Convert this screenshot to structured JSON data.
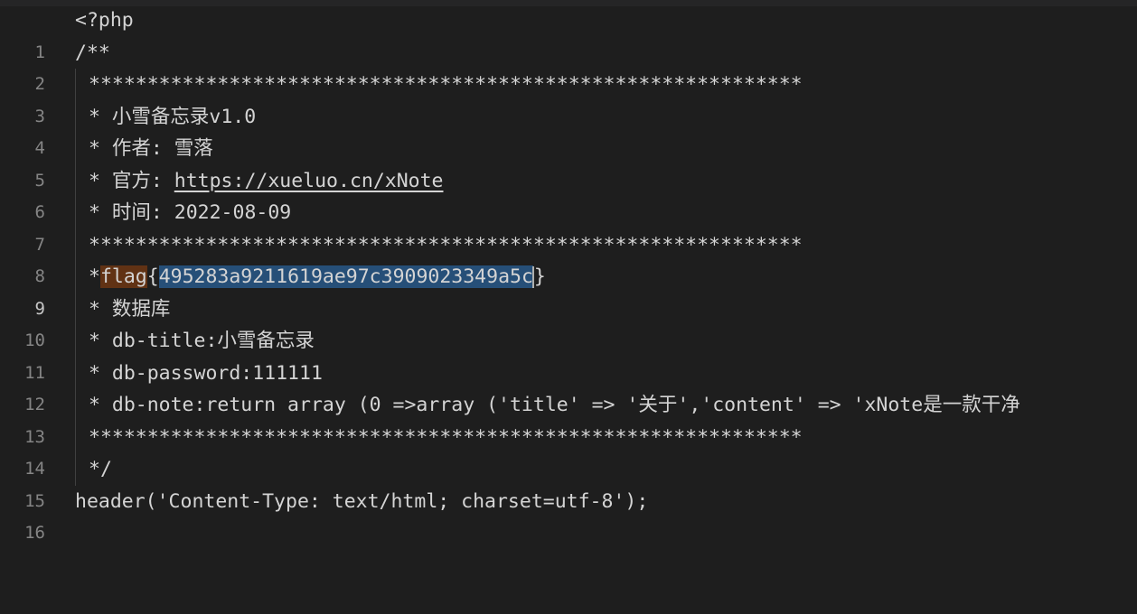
{
  "editor": {
    "lines": [
      {
        "num": "1",
        "text": "<?php"
      },
      {
        "num": "2",
        "text": "/**"
      },
      {
        "num": "3",
        "text": "*************************************************************"
      },
      {
        "num": "4",
        "text": "* 小雪备忘录v1.0"
      },
      {
        "num": "5",
        "text": "* 作者: 雪落"
      },
      {
        "num": "6",
        "pre": "* 官方: ",
        "url": "https://xueluo.cn/xNote"
      },
      {
        "num": "7",
        "text": "* 时间: 2022-08-09"
      },
      {
        "num": "8",
        "text": "*************************************************************"
      },
      {
        "num": "9",
        "star": "*",
        "word": "flag",
        "brace_open": "{",
        "selected": "495283a9211619ae97c3909023349a5c",
        "brace_close": "}"
      },
      {
        "num": "10",
        "text": "* 数据库"
      },
      {
        "num": "11",
        "text": "* db-title:小雪备忘录"
      },
      {
        "num": "12",
        "text": "* db-password:111111"
      },
      {
        "num": "13",
        "text": "* db-note:return array (0 =>array ('title' => '关于','content' => 'xNote是一款干净"
      },
      {
        "num": "14",
        "text": "*************************************************************"
      },
      {
        "num": "15",
        "text": "*/"
      },
      {
        "num": "16",
        "text": "header('Content-Type: text/html; charset=utf-8');"
      }
    ]
  },
  "colors": {
    "background": "#1e1e1e",
    "text": "#d4d4d4",
    "line_number": "#858585",
    "word_highlight": "#613214",
    "selection": "#264f78"
  }
}
